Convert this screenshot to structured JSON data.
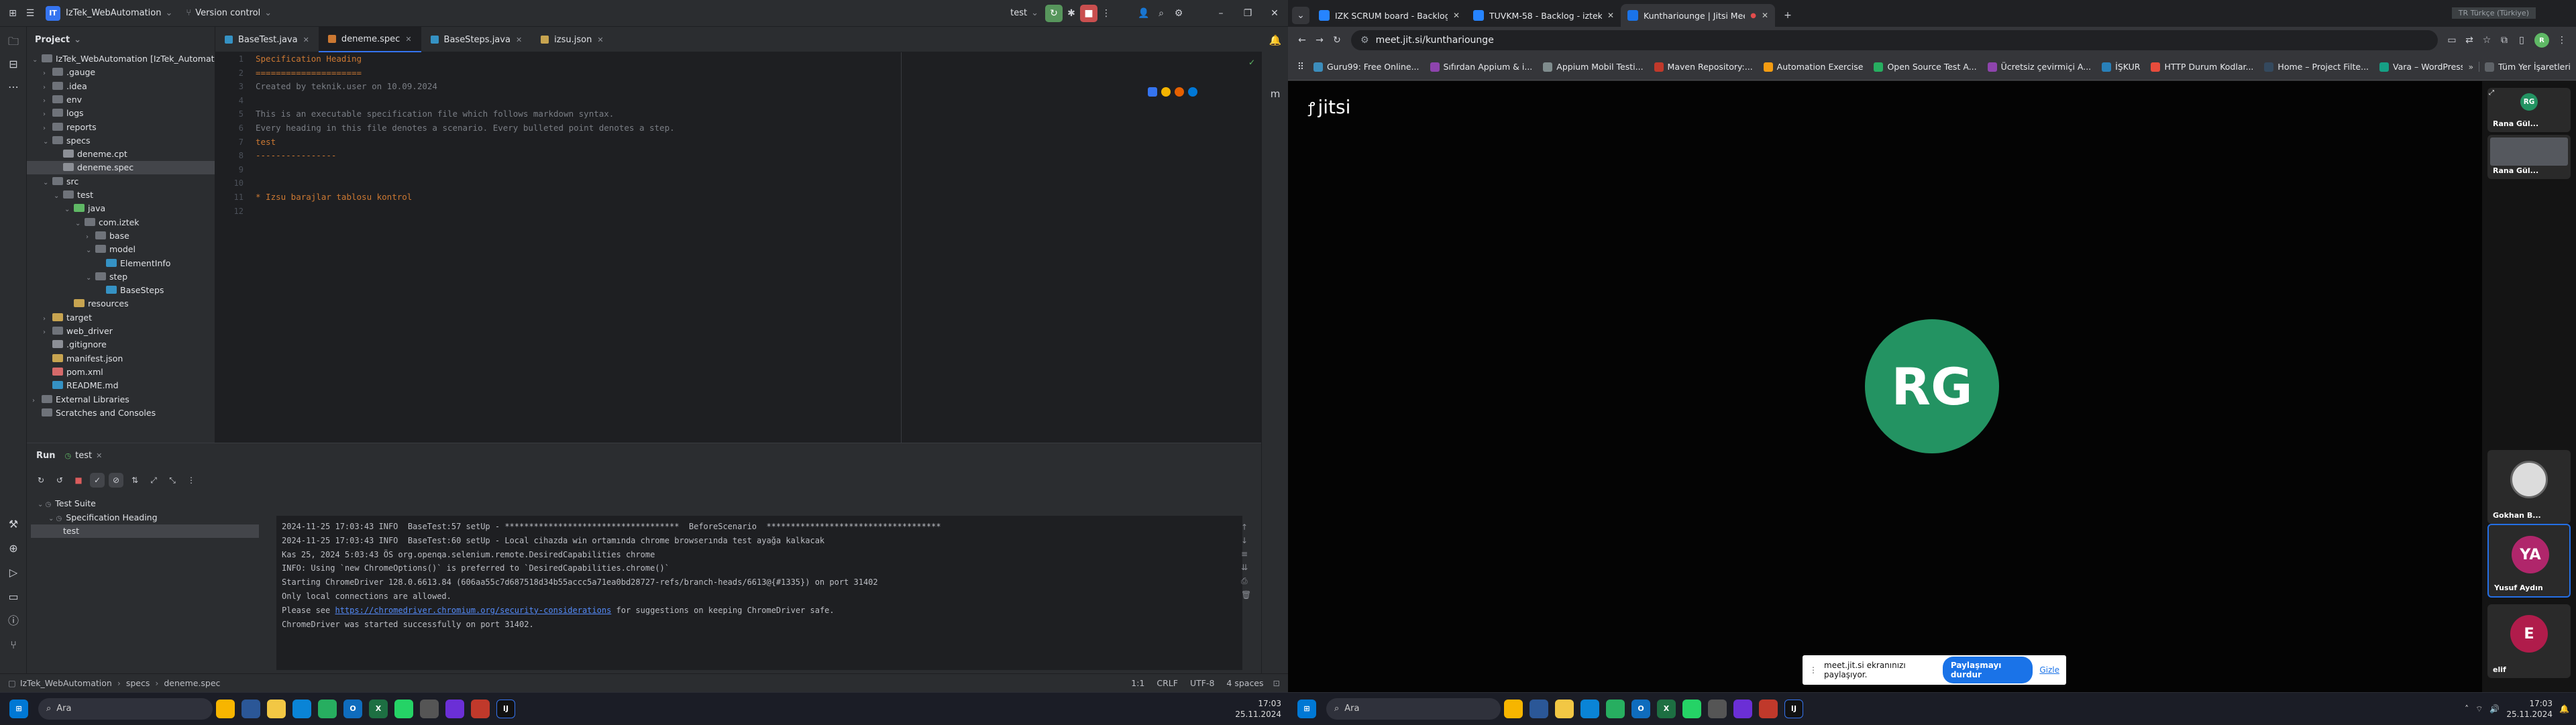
{
  "ide": {
    "project_name": "IzTek_WebAutomation",
    "project_badge": "IT",
    "vcs_label": "Version control",
    "run_config": "test",
    "tabs": [
      {
        "label": "BaseTest.java"
      },
      {
        "label": "deneme.spec"
      },
      {
        "label": "BaseSteps.java"
      },
      {
        "label": "izsu.json"
      }
    ],
    "project_header": "Project",
    "tree": [
      {
        "label": "IzTek_WebAutomation [IzTek_Automation]",
        "depth": 0,
        "chev": "⌄",
        "color": "#6f737a"
      },
      {
        "label": ".gauge",
        "depth": 1,
        "chev": "›",
        "color": "#6f737a"
      },
      {
        "label": ".idea",
        "depth": 1,
        "chev": "›",
        "color": "#6f737a"
      },
      {
        "label": "env",
        "depth": 1,
        "chev": "›",
        "color": "#6f737a"
      },
      {
        "label": "logs",
        "depth": 1,
        "chev": "›",
        "color": "#6f737a"
      },
      {
        "label": "reports",
        "depth": 1,
        "chev": "›",
        "color": "#6f737a"
      },
      {
        "label": "specs",
        "depth": 1,
        "chev": "⌄",
        "color": "#6f737a"
      },
      {
        "label": "deneme.cpt",
        "depth": 2,
        "chev": "",
        "color": "#8c8f96"
      },
      {
        "label": "deneme.spec",
        "depth": 2,
        "chev": "",
        "color": "#8c8f96",
        "selected": true
      },
      {
        "label": "src",
        "depth": 1,
        "chev": "⌄",
        "color": "#6f737a"
      },
      {
        "label": "test",
        "depth": 2,
        "chev": "⌄",
        "color": "#6f737a"
      },
      {
        "label": "java",
        "depth": 3,
        "chev": "⌄",
        "color": "#5fb865"
      },
      {
        "label": "com.iztek",
        "depth": 4,
        "chev": "⌄",
        "color": "#6f737a"
      },
      {
        "label": "base",
        "depth": 5,
        "chev": "›",
        "color": "#6f737a"
      },
      {
        "label": "model",
        "depth": 5,
        "chev": "⌄",
        "color": "#6f737a"
      },
      {
        "label": "ElementInfo",
        "depth": 6,
        "chev": "",
        "color": "#3592c4"
      },
      {
        "label": "step",
        "depth": 5,
        "chev": "⌄",
        "color": "#6f737a"
      },
      {
        "label": "BaseSteps",
        "depth": 6,
        "chev": "",
        "color": "#3592c4"
      },
      {
        "label": "resources",
        "depth": 3,
        "chev": "",
        "color": "#c7a450"
      },
      {
        "label": "target",
        "depth": 1,
        "chev": "›",
        "color": "#c7a450"
      },
      {
        "label": "web_driver",
        "depth": 1,
        "chev": "›",
        "color": "#6f737a"
      },
      {
        "label": ".gitignore",
        "depth": 1,
        "chev": "",
        "color": "#8c8f96"
      },
      {
        "label": "manifest.json",
        "depth": 1,
        "chev": "",
        "color": "#c7a450"
      },
      {
        "label": "pom.xml",
        "depth": 1,
        "chev": "",
        "color": "#d66a6a"
      },
      {
        "label": "README.md",
        "depth": 1,
        "chev": "",
        "color": "#3592c4"
      },
      {
        "label": "External Libraries",
        "depth": 0,
        "chev": "›",
        "color": "#6f737a"
      },
      {
        "label": "Scratches and Consoles",
        "depth": 0,
        "chev": "",
        "color": "#6f737a"
      }
    ],
    "gutter": [
      "1",
      "2",
      "3",
      "4",
      "5",
      "6",
      "7",
      "8",
      "9",
      "10",
      "11",
      "12"
    ],
    "code": [
      {
        "text": "Specification Heading",
        "color": "#cc7832"
      },
      {
        "text": "=====================",
        "color": "#cc7832"
      },
      {
        "text": "Created by teknik.user on 10.09.2024",
        "color": "#7a7e85"
      },
      {
        "text": "",
        "color": "#bcbec4"
      },
      {
        "text": "This is an executable specification file which follows markdown syntax.",
        "color": "#7a7e85"
      },
      {
        "text": "Every heading in this file denotes a scenario. Every bulleted point denotes a step.",
        "color": "#7a7e85"
      },
      {
        "text": "test",
        "color": "#cc7832"
      },
      {
        "text": "----------------",
        "color": "#cc7832"
      },
      {
        "text": "",
        "color": "#bcbec4"
      },
      {
        "text": "",
        "color": "#bcbec4"
      },
      {
        "text": "* Izsu barajlar tablosu kontrol",
        "color": "#cc7832"
      },
      {
        "text": "",
        "color": "#bcbec4"
      }
    ],
    "run": {
      "label": "Run",
      "config": "test",
      "tree": [
        {
          "label": "Test Suite",
          "depth": 0
        },
        {
          "label": "Specification Heading",
          "depth": 1
        },
        {
          "label": "test",
          "depth": 2,
          "selected": true
        }
      ],
      "console": [
        {
          "text": "2024-11-25 17:03:43 INFO  BaseTest:57 setUp - ************************************  BeforeScenario  ************************************",
          "link": ""
        },
        {
          "text": "2024-11-25 17:03:43 INFO  BaseTest:60 setUp - Local cihazda win ortamında chrome browserında test ayağa kalkacak",
          "link": ""
        },
        {
          "text": "Kas 25, 2024 5:03:43 ÖS org.openqa.selenium.remote.DesiredCapabilities chrome",
          "link": ""
        },
        {
          "text": "INFO: Using `new ChromeOptions()` is preferred to `DesiredCapabilities.chrome()`",
          "link": ""
        },
        {
          "text": "Starting ChromeDriver 128.0.6613.84 (606aa55c7d687518d34b55accc5a71ea0bd28727-refs/branch-heads/6613@{#1335}) on port 31402",
          "link": ""
        },
        {
          "text": "Only local connections are allowed.",
          "link": ""
        },
        {
          "text": "Please see ",
          "link": "https://chromedriver.chromium.org/security-considerations",
          "after": " for suggestions on keeping ChromeDriver safe."
        },
        {
          "text": "ChromeDriver was started successfully on port 31402.",
          "link": ""
        }
      ]
    },
    "status": {
      "breadcrumb": [
        "IzTek_WebAutomation",
        "specs",
        "deneme.spec"
      ],
      "position": "1:1",
      "line_sep": "CRLF",
      "encoding": "UTF-8",
      "indent": "4 spaces"
    }
  },
  "browser": {
    "tabs": [
      {
        "title": "IZK SCRUM board - Backlog - I",
        "color": "#2684ff"
      },
      {
        "title": "TUVKM-58 - Backlog - iztek",
        "color": "#2684ff"
      },
      {
        "title": "Kunthariounge | Jitsi Meet",
        "color": "#1a73e8",
        "active": true
      }
    ],
    "corner_label": "TR Türkçe (Türkiye)",
    "url": "meet.jit.si/kunthariounge",
    "bookmarks": [
      {
        "label": "Guru99: Free Online...",
        "color": "#3c8dbc"
      },
      {
        "label": "Sıfırdan Appium & i...",
        "color": "#8e44ad"
      },
      {
        "label": "Appium Mobil Testi...",
        "color": "#7f8c8d"
      },
      {
        "label": "Maven Repository:...",
        "color": "#c0392b"
      },
      {
        "label": "Automation Exercise",
        "color": "#f39c12"
      },
      {
        "label": "Open Source Test A...",
        "color": "#27ae60"
      },
      {
        "label": "Ücretsiz çevirmiçi A...",
        "color": "#8e44ad"
      },
      {
        "label": "İŞKUR",
        "color": "#2980b9"
      },
      {
        "label": "HTTP Durum Kodlar...",
        "color": "#e74c3c"
      },
      {
        "label": "Home – Project Filte...",
        "color": "#34495e"
      },
      {
        "label": "Vara – WordPress T...",
        "color": "#16a085"
      }
    ],
    "all_bookmarks": "Tüm Yer İşaretleri",
    "jitsi_logo": "jitsi",
    "main_avatar": {
      "initials": "RG",
      "color": "#239362"
    },
    "participants": [
      {
        "name": "Rana Gül...",
        "initials": "RG",
        "color": "#239362",
        "type": "avatar"
      },
      {
        "name": "Rana Gül...",
        "type": "screen"
      },
      {
        "name": "Gokhan B...",
        "type": "photo"
      },
      {
        "name": "Yusuf Aydın",
        "initials": "YA",
        "color": "#b0266b",
        "type": "avatar",
        "speaking": true
      },
      {
        "name": "elif",
        "initials": "E",
        "color": "#b01c4b",
        "type": "avatar"
      }
    ],
    "share_text": "meet.jit.si ekranınızı paylaşıyor.",
    "share_stop": "Paylaşmayı durdur",
    "share_hide": "Gizle"
  },
  "taskbar": {
    "search": "Ara",
    "time": "17:03",
    "date": "25.11.2024"
  }
}
